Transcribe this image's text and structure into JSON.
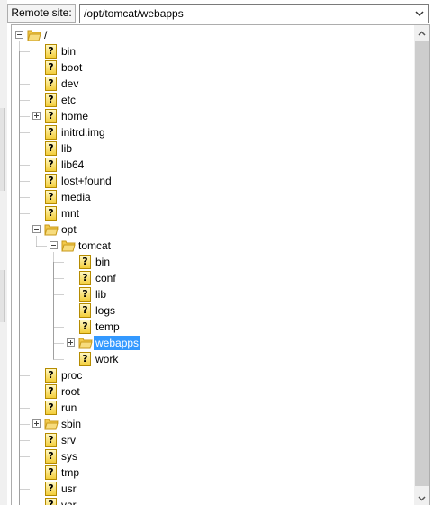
{
  "remote_site": {
    "label": "Remote site:",
    "path": "/opt/tomcat/webapps"
  },
  "tree": {
    "nodes": [
      {
        "name": "/",
        "depth": 0,
        "icon": "folder-icon",
        "expander": "minus"
      },
      {
        "name": "bin",
        "depth": 1,
        "icon": "question-icon"
      },
      {
        "name": "boot",
        "depth": 1,
        "icon": "question-icon"
      },
      {
        "name": "dev",
        "depth": 1,
        "icon": "question-icon"
      },
      {
        "name": "etc",
        "depth": 1,
        "icon": "question-icon"
      },
      {
        "name": "home",
        "depth": 1,
        "icon": "question-icon",
        "expander": "plus"
      },
      {
        "name": "initrd.img",
        "depth": 1,
        "icon": "question-icon"
      },
      {
        "name": "lib",
        "depth": 1,
        "icon": "question-icon"
      },
      {
        "name": "lib64",
        "depth": 1,
        "icon": "question-icon"
      },
      {
        "name": "lost+found",
        "depth": 1,
        "icon": "question-icon"
      },
      {
        "name": "media",
        "depth": 1,
        "icon": "question-icon"
      },
      {
        "name": "mnt",
        "depth": 1,
        "icon": "question-icon"
      },
      {
        "name": "opt",
        "depth": 1,
        "icon": "folder-icon",
        "expander": "minus"
      },
      {
        "name": "tomcat",
        "depth": 2,
        "icon": "folder-icon",
        "expander": "minus"
      },
      {
        "name": "bin",
        "depth": 3,
        "icon": "question-icon"
      },
      {
        "name": "conf",
        "depth": 3,
        "icon": "question-icon"
      },
      {
        "name": "lib",
        "depth": 3,
        "icon": "question-icon"
      },
      {
        "name": "logs",
        "depth": 3,
        "icon": "question-icon"
      },
      {
        "name": "temp",
        "depth": 3,
        "icon": "question-icon"
      },
      {
        "name": "webapps",
        "depth": 3,
        "icon": "folder-icon",
        "expander": "plus",
        "selected": true
      },
      {
        "name": "work",
        "depth": 3,
        "icon": "question-icon"
      },
      {
        "name": "proc",
        "depth": 1,
        "icon": "question-icon"
      },
      {
        "name": "root",
        "depth": 1,
        "icon": "question-icon"
      },
      {
        "name": "run",
        "depth": 1,
        "icon": "question-icon"
      },
      {
        "name": "sbin",
        "depth": 1,
        "icon": "folder-icon",
        "expander": "plus"
      },
      {
        "name": "srv",
        "depth": 1,
        "icon": "question-icon"
      },
      {
        "name": "sys",
        "depth": 1,
        "icon": "question-icon"
      },
      {
        "name": "tmp",
        "depth": 1,
        "icon": "question-icon"
      },
      {
        "name": "usr",
        "depth": 1,
        "icon": "question-icon"
      },
      {
        "name": "var",
        "depth": 1,
        "icon": "question-icon"
      }
    ]
  },
  "colors": {
    "selection": "#3399ff",
    "folder": "#f2c94c",
    "question_icon_bg": "#f3cd3a"
  }
}
